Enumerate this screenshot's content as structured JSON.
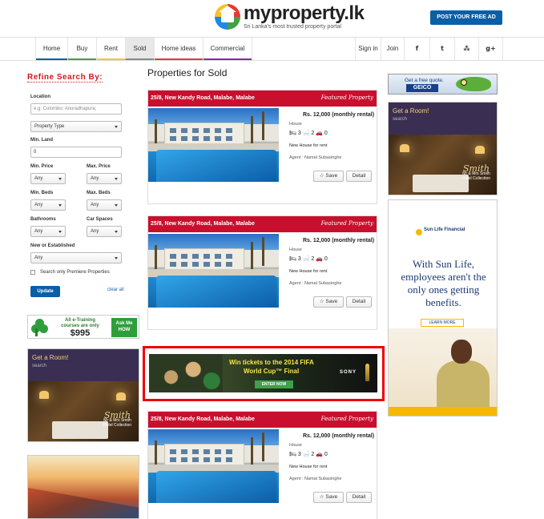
{
  "header": {
    "logo_name": "myproperty.lk",
    "logo_tagline": "Sri Lanka's most trusted property portal",
    "post_ad": "POST YOUR FREE AD"
  },
  "nav": {
    "items": [
      "Home",
      "Buy",
      "Rent",
      "Sold",
      "Home ideas",
      "Commercial"
    ],
    "active": "Sold",
    "right": [
      "Sign in",
      "Join"
    ],
    "social_icons": [
      "facebook-icon",
      "twitter-icon",
      "rss-icon",
      "google-plus-icon"
    ],
    "social_glyphs": [
      "f",
      "t",
      "⁂",
      "g+"
    ]
  },
  "sidebar": {
    "title": "Refine Search By:",
    "location_label": "Location",
    "location_placeholder": "e.g: Colombo; Anuradhapura;",
    "property_type": "Property Type",
    "min_land_label": "Min. Land",
    "min_land_value": "0",
    "min_price_label": "Min. Price",
    "max_price_label": "Max. Price",
    "min_beds_label": "Min. Beds",
    "max_beds_label": "Max. Beds",
    "bathrooms_label": "Bathrooms",
    "car_spaces_label": "Car Spaces",
    "any": "Any",
    "new_established_label": "New or Established",
    "premiere_label": "Search only Premiere Properties",
    "update": "Update",
    "clear_all": "clear all"
  },
  "main": {
    "title": "Properties for Sold",
    "listings": [
      {
        "address": "25/8, New Kandy Road, Malabe, Malabe",
        "featured": "Featured Property",
        "price": "Rs. 12,000 (monthly rental)",
        "type": "House",
        "beds": "3",
        "baths": "2",
        "cars": "0",
        "description": "New House for rent",
        "agent": "Agent : Namal Subasinghe",
        "save": "Save",
        "detail": "Detail"
      },
      {
        "address": "25/8, New Kandy Road, Malabe, Malabe",
        "featured": "Featured Property",
        "price": "Rs. 12,000 (monthly rental)",
        "type": "House",
        "beds": "3",
        "baths": "2",
        "cars": "0",
        "description": "New House for rent",
        "agent": "Agent : Namal Subasinghe",
        "save": "Save",
        "detail": "Detail"
      },
      {
        "address": "25/8, New Kandy Road, Malabe, Malabe",
        "featured": "Featured Property",
        "price": "Rs. 12,000 (monthly rental)",
        "type": "House",
        "beds": "3",
        "baths": "2",
        "cars": "0",
        "description": "New House for rent",
        "agent": "Agent : Namal Subasinghe",
        "save": "Save",
        "detail": "Detail"
      }
    ]
  },
  "ads": {
    "training_line1": "All e-Training",
    "training_line2": "courses are only",
    "training_price": "$995",
    "training_ask": "Ask Me HOW",
    "room_title": "Get a Room!",
    "room_sub": "search",
    "room_brand": "Mr & Mrs Smith",
    "room_brand_sub": "Hotel Collection",
    "room_script": "Smith",
    "fifa_line1": "Win tickets to the 2014 FIFA",
    "fifa_line2": "World Cup™ Final",
    "fifa_enter": "ENTER NOW",
    "fifa_sony": "SONY",
    "geico_quote": "Get a free quote.",
    "geico_brand": "GEICO",
    "sunlife_brand": "Sun Life Financial",
    "sunlife_msg": "With Sun Life, employees aren't the only ones getting benefits.",
    "sunlife_learn": "LEARN MORE"
  },
  "colors": {
    "brand_red": "#c8102e",
    "brand_blue": "#0a5fa6",
    "refine_red": "#c81e1e"
  }
}
